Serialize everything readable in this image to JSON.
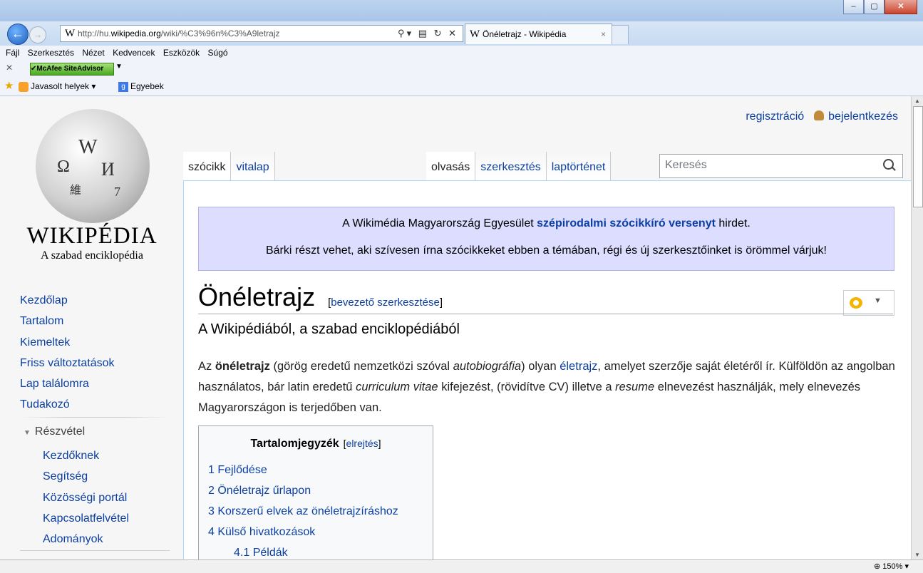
{
  "browser": {
    "url_prefix": "http://hu.",
    "url_host": "wikipedia.org",
    "url_path": "/wiki/%C3%96n%C3%A9letrajz",
    "tab_title": "Önéletrajz - Wikipédia",
    "tab_close": "×",
    "menu": [
      "Fájl",
      "Szerkesztés",
      "Nézet",
      "Kedvencek",
      "Eszközök",
      "Súgó"
    ],
    "mcafee_label": "McAfee SiteAdvisor",
    "favorites": {
      "suggested": "Javasolt helyek ▾",
      "other": "Egyebek"
    },
    "zoom": "150%",
    "window_buttons": [
      "–",
      "▢",
      "✕"
    ]
  },
  "wiki": {
    "wordmark": "WIKIPÉDIA",
    "tagline": "A szabad enciklopédia",
    "personal": {
      "register": "regisztráció",
      "login": "bejelentkezés"
    },
    "nav": [
      "Kezdőlap",
      "Tartalom",
      "Kiemeltek",
      "Friss változtatások",
      "Lap találomra",
      "Tudakozó"
    ],
    "portal": {
      "heading": "Részvétel",
      "links": [
        "Kezdőknek",
        "Segítség",
        "Közösségi portál",
        "Kapcsolatfelvétel",
        "Adományok"
      ]
    },
    "tabs_left": [
      "szócikk",
      "vitalap"
    ],
    "tabs_right": [
      "olvasás",
      "szerkesztés",
      "laptörténet"
    ],
    "search_placeholder": "Keresés",
    "notice": {
      "line1_before": "A Wikimédia Magyarország Egyesület ",
      "line1_link": "szépirodalmi szócikkíró versenyt",
      "line1_after": " hirdet.",
      "line2": "Bárki részt vehet, aki szívesen írna szócikkeket ebben a témában, régi és új szerkesztőinket is örömmel várjuk!"
    },
    "title": "Önéletrajz",
    "edit_link": "bevezető szerkesztése",
    "subtitle": "A Wikipédiából, a szabad enciklopédiából",
    "para": {
      "t1": "Az ",
      "b1": "önéletrajz",
      "t2": " (görög eredetű nemzetközi szóval ",
      "i1": "autobiográfia",
      "t3": ") olyan ",
      "a1": "életrajz",
      "t4": ", amelyet szerzője saját életéről ír. Külföldön az angolban használatos, bár latin eredetű ",
      "i2": "curriculum vitae",
      "t5": " kifejezést, (rövidítve CV) illetve a ",
      "i3": "resume",
      "t6": " elnevezést használják, mely elnevezés Magyarországon is terjedőben van."
    },
    "toc": {
      "title": "Tartalomjegyzék",
      "hide": "elrejtés",
      "items": [
        "1 Fejlődése",
        "2 Önéletrajz űrlapon",
        "3 Korszerű elvek az önéletrajzíráshoz",
        "4 Külső hivatkozások",
        "4.1 Példák"
      ]
    }
  }
}
